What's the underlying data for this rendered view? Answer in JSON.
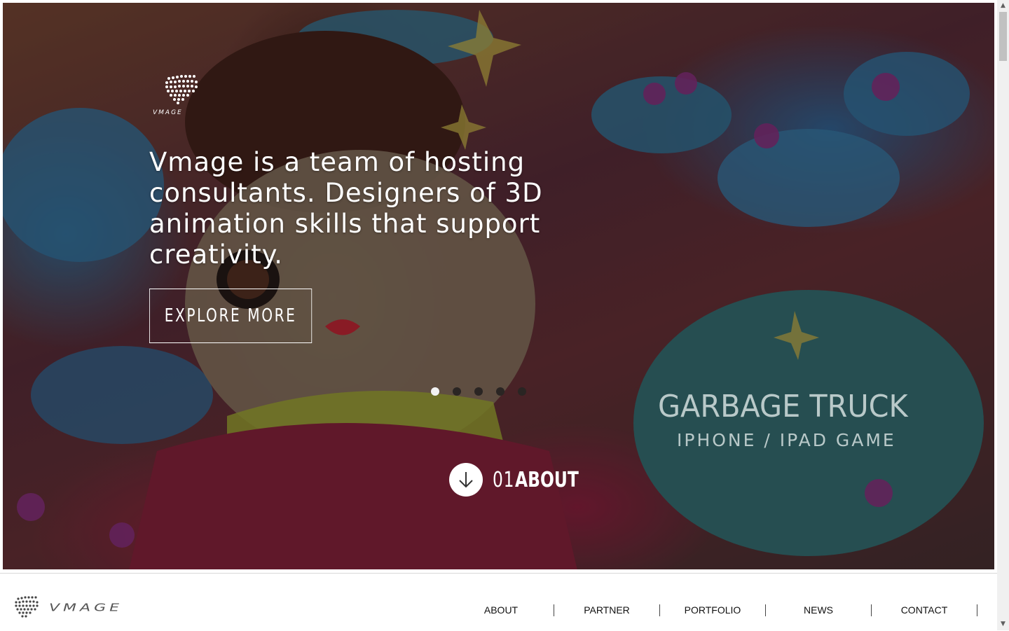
{
  "hero": {
    "headline": "Vmage is a team of hosting consultants. Designers of 3D animation skills that support creativity.",
    "cta_label": "EXPLORE MORE",
    "slides": [
      "1",
      "2",
      "3",
      "4",
      "5"
    ],
    "active_slide": 1,
    "scroll_cue": {
      "number": "01",
      "label": "ABOUT"
    },
    "promo_title": "GARBAGE TRUCK",
    "promo_subtitle": "IPHONE / IPAD GAME",
    "logo_text": "VMAGE"
  },
  "nav": {
    "logo_text": "VMAGE",
    "items": [
      {
        "label": "ABOUT"
      },
      {
        "label": "PARTNER"
      },
      {
        "label": "PORTFOLIO"
      },
      {
        "label": "NEWS"
      },
      {
        "label": "CONTACT"
      }
    ]
  },
  "icons": {
    "hero_logo": "vmage-logo-icon",
    "scroll_down": "arrow-down-icon"
  },
  "colors": {
    "accent": "#ffffff",
    "hero_bg": "#5b2a2e",
    "nav_text": "#111111"
  }
}
